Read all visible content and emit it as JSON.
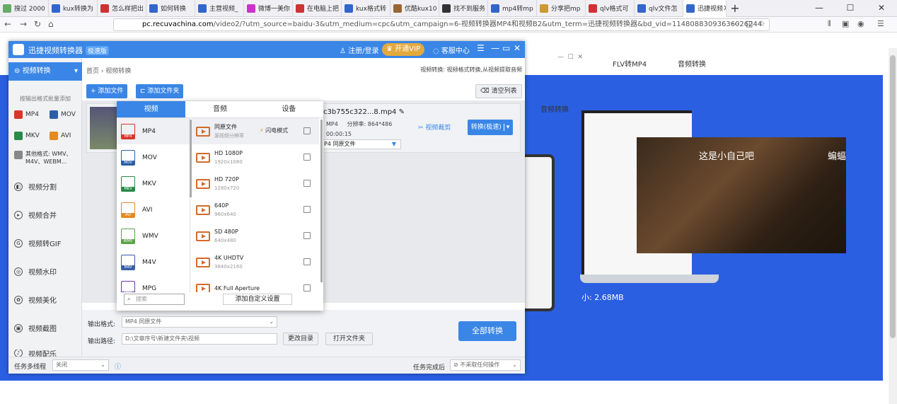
{
  "browser": {
    "tabs": [
      {
        "label": "搜过 2000",
        "color": "#6a6"
      },
      {
        "label": "kux转换为",
        "color": "#36c"
      },
      {
        "label": "怎么样把出",
        "color": "#c33"
      },
      {
        "label": "如何转换",
        "color": "#36c"
      },
      {
        "label": "主营视频_",
        "color": "#36c"
      },
      {
        "label": "微博一美你",
        "color": "#c3c"
      },
      {
        "label": "在电脑上把",
        "color": "#c33"
      },
      {
        "label": "kux格式转",
        "color": "#36c"
      },
      {
        "label": "优酷kux10",
        "color": "#963"
      },
      {
        "label": "找不到服务",
        "color": "#333"
      },
      {
        "label": "mp4转mp",
        "color": "#36c"
      },
      {
        "label": "分享把mp",
        "color": "#c93"
      },
      {
        "label": "qlv格式可",
        "color": "#c33"
      },
      {
        "label": "qlv文件怎",
        "color": "#36c"
      },
      {
        "label": "迅捷视频转",
        "color": "#36c"
      }
    ],
    "active_tab": "迅捷视频",
    "url_domain": "pc.recuvachina.com",
    "url_path": "/video2/?utm_source=baidu-3&utm_medium=cpc&utm_campaign=6-视频转换器MP4和视频B2&utm_term=迅捷视频转换器&bd_vid=11480883093636026244"
  },
  "webpage": {
    "nav": [
      "FLV转MP4",
      "音频转换"
    ],
    "nav2": "音频转换",
    "caption_left": "这是小自己吧",
    "caption_right": "蝙蝠",
    "size": "小: 2.68MB"
  },
  "app": {
    "title": "迅捷视频转换器",
    "edition": "极速版",
    "login": "注册/登录",
    "vip": "开通VIP",
    "service": "客服中心",
    "sidebar": {
      "active": "视频转换",
      "hint": "按输出格式批量添加",
      "formats": [
        "MP4",
        "MOV",
        "MKV",
        "AVI"
      ],
      "other": "其他格式: WMV、M4V、WEBM...",
      "items": [
        "视频分割",
        "视频合并",
        "视频转GIF",
        "视频水印",
        "视频美化",
        "视频截图",
        "视频配乐"
      ]
    },
    "breadcrumb": "首页 › 视频转换",
    "note": "视频转换: 视频格式转换,从视频提取音频",
    "add_file": "+ 添加文件",
    "add_folder": "添加文件夹",
    "clear_list": "清空列表",
    "file": {
      "name": "c3b755c322...8.mp4",
      "format": "MP4",
      "resolution_label": "分辨率:",
      "resolution": "864*486",
      "duration": "00:00:15",
      "output": "P4 同原文件",
      "clip": "视频裁剪",
      "convert": "转换(极速)"
    },
    "output_format_label": "输出格式:",
    "output_format": "MP4 同原文件",
    "output_path_label": "输出路径:",
    "output_path": "D:\\文章序号\\新建文件夹\\视频",
    "change_dir": "更改目录",
    "open_folder": "打开文件夹",
    "convert_all": "全部转换",
    "multithread_label": "任务多线程",
    "multithread": "关闭",
    "after_label": "任务完成后",
    "after": "不采取任何操作"
  },
  "popup": {
    "tabs": [
      "视频",
      "音频",
      "设备"
    ],
    "formats": [
      {
        "name": "MP4",
        "color": "#d9362b"
      },
      {
        "name": "MOV",
        "color": "#2b5fa8"
      },
      {
        "name": "MKV",
        "color": "#2a8a4a"
      },
      {
        "name": "AVI",
        "color": "#e58a1e"
      },
      {
        "name": "WMV",
        "color": "#5aa34a"
      },
      {
        "name": "M4V",
        "color": "#3a5fa8"
      },
      {
        "name": "MPG",
        "color": "#6b3aa8"
      }
    ],
    "qualities": [
      {
        "name": "同原文件",
        "sub": "源视频分辨率"
      },
      {
        "name": "HD 1080P",
        "sub": "1920x1080"
      },
      {
        "name": "HD 720P",
        "sub": "1280x720"
      },
      {
        "name": "640P",
        "sub": "960x640"
      },
      {
        "name": "SD 480P",
        "sub": "640x480"
      },
      {
        "name": "4K UHDTV",
        "sub": "3840x2160"
      },
      {
        "name": "4K Full Aperture",
        "sub": ""
      }
    ],
    "flash": "闪电模式",
    "search": "搜索",
    "custom": "添加自定义设置"
  }
}
